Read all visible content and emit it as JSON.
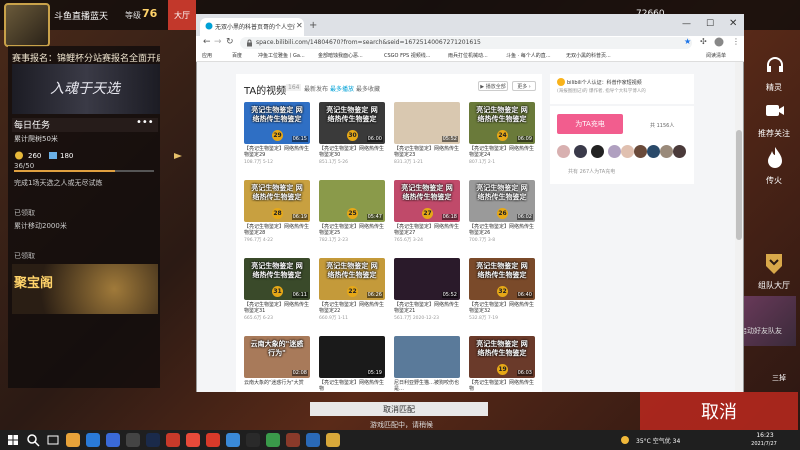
{
  "game": {
    "player_name": "斗鱼直播蓝天",
    "level_label": "等级",
    "level_value": "76",
    "hall_tab": "大厅",
    "coins_value": "72660",
    "event_title": "赛事报名：锦鲤杯分站赛报名全面开启",
    "event_banner_text": "入魂于天选",
    "daily_title": "每日任务",
    "daily_more": "•••",
    "daily_sub": "累计爬树50米",
    "reward_gold": "260",
    "reward_exp": "180",
    "progress_text": "36/50",
    "progress_fraction": 0.72,
    "task_line_1": "完成1场天选之人或无尽试炼",
    "claimed_1": "已领取",
    "task_line_2": "累计移动2000米",
    "claimed_2": "已领取",
    "treasure_label": "聚宝阁",
    "right_column": {
      "wonder": "精灵",
      "recommend": "推荐关注",
      "fire": "传火",
      "team": "组队大厅",
      "friend_text": "启动好友队友",
      "sanhuan": "三掉"
    },
    "cancel_big": "取消",
    "cancel_match": "取消匹配",
    "matching_status": "游戏匹配中，请稍候"
  },
  "browser": {
    "tab_title": "无双小黑的科普页哥的个人空间",
    "url": "space.bilibili.com/14804670?from=search&seid=16725140067271201615",
    "bookmarks": [
      "应用",
      "百度",
      "冲鱼工位雅鱼丨Ga...",
      "金部暗蚀我面心恶...",
      "CSGO FPS 视频线...",
      "雨兵打位机械动...",
      "斗鱼 · 每个人的直...",
      "无双小黑的科普页..."
    ],
    "reading_list": "阅读清单"
  },
  "space": {
    "ta_title": "TA的视频",
    "ta_count": "164",
    "sort_latest": "最新发布",
    "sort_play": "最多播放",
    "sort_fav": "最多收藏",
    "play_all": "▶ 播放全部",
    "more": "更多 ›",
    "videos": [
      {
        "cap": "亮记生物鉴定 网络热传生物鉴定",
        "ep": "29",
        "dur": "06:15",
        "title": "【亮记生物鉴定】网络热传生物鉴定29",
        "meta": "108.7万  5-12",
        "bg": "#2f6fc4"
      },
      {
        "cap": "亮记生物鉴定 网络热传生物鉴定",
        "ep": "30",
        "dur": "06:00",
        "title": "【亮记生物鉴定】网络热传生物鉴定30",
        "meta": "851.1万  5-26",
        "bg": "#3a3a3a"
      },
      {
        "cap": "",
        "ep": "",
        "dur": "05:52",
        "title": "【亮记生物鉴定】网络热传生物鉴定23",
        "meta": "831.3万  1-21",
        "bg": "#d9c8b0"
      },
      {
        "cap": "亮记生物鉴定 网络热传生物鉴定",
        "ep": "24",
        "dur": "06:09",
        "title": "【亮记生物鉴定】网络热传生物鉴定24",
        "meta": "807.1万  2-1",
        "bg": "#6a7a3a"
      },
      {
        "cap": "亮记生物鉴定 网络热传生物鉴定",
        "ep": "28",
        "dur": "06:19",
        "title": "【亮记生物鉴定】网络热传生物鉴定28",
        "meta": "796.7万  4-22",
        "bg": "#c8a040"
      },
      {
        "cap": "",
        "ep": "25",
        "dur": "05:47",
        "title": "【亮记生物鉴定】网络热传生物鉴定25",
        "meta": "782.1万  2-23",
        "bg": "#8a9a4a"
      },
      {
        "cap": "亮记生物鉴定 网络热传生物鉴定",
        "ep": "27",
        "dur": "06:18",
        "title": "【亮记生物鉴定】网络热传生物鉴定27",
        "meta": "765.6万  3-24",
        "bg": "#c04a6a"
      },
      {
        "cap": "亮记生物鉴定 网络热传生物鉴定",
        "ep": "26",
        "dur": "06:02",
        "title": "【亮记生物鉴定】网络热传生物鉴定26",
        "meta": "700.7万  3-8",
        "bg": "#9a9a9a"
      },
      {
        "cap": "亮记生物鉴定 网络热传生物鉴定",
        "ep": "31",
        "dur": "06:11",
        "title": "【亮记生物鉴定】网络热传生物鉴定31",
        "meta": "665.6万  6-23",
        "bg": "#3a4a2a"
      },
      {
        "cap": "亮记生物鉴定 网络热传生物鉴定",
        "ep": "22",
        "dur": "06:26",
        "title": "【亮记生物鉴定】网络热传生物鉴定22",
        "meta": "660.9万  1-11",
        "bg": "#c49a3a"
      },
      {
        "cap": "",
        "ep": "",
        "dur": "05:52",
        "title": "【亮记生物鉴定】网络热传生物鉴定21",
        "meta": "561.7万  2020-12-23",
        "bg": "#2a1a2a"
      },
      {
        "cap": "亮记生物鉴定 网络热传生物鉴定",
        "ep": "32",
        "dur": "06:40",
        "title": "【亮记生物鉴定】网络热传生物鉴定32",
        "meta": "532.8万  7-19",
        "bg": "#7a4a2a"
      },
      {
        "cap": "云南大象的\"迷惑行为\"",
        "ep": "",
        "dur": "02:08",
        "title": "云南大象的\"迷惑行为\"大赏",
        "meta": "",
        "bg": "#a87a5a"
      },
      {
        "cap": "",
        "ep": "",
        "dur": "05:19",
        "title": "【亮记生物鉴定】网络热传生物",
        "meta": "",
        "bg": "#1a1a1a"
      },
      {
        "cap": "",
        "ep": "",
        "dur": "",
        "title": "尼日利亚野生猫…被狗咬伤也是…",
        "meta": "",
        "bg": "#5a7a9a"
      },
      {
        "cap": "亮记生物鉴定 网络热传生物鉴定",
        "ep": "19",
        "dur": "06:03",
        "title": "【亮记生物鉴定】网络热传生物",
        "meta": "",
        "bg": "#6a3a2a"
      }
    ],
    "cert_text": "bilibili个人认证：科普作家短视频",
    "cert_sub": "(海报图图记)的 爆作者, 指导个大科学博人的",
    "charge_btn": "为TA充电",
    "charge_count": "共 1156人",
    "fans_text": "共有 267人为TA充电"
  },
  "taskbar": {
    "weather": "35°C 空气优 34",
    "clock": "16:23",
    "date": "2021/7/27"
  }
}
